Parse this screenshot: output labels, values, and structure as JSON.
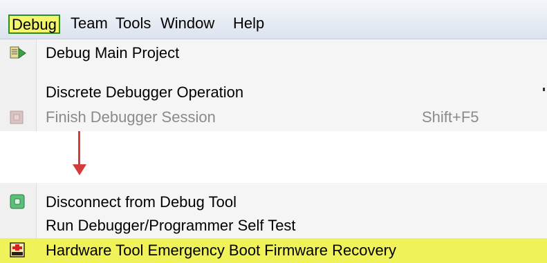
{
  "menubar": {
    "items": [
      "Debug",
      "Team",
      "Tools",
      "Window",
      "Help"
    ]
  },
  "menu_top": [
    {
      "label": "Debug Main Project",
      "icon": "debug-project-icon",
      "enabled": true
    },
    {
      "label": "Discrete Debugger Operation",
      "enabled": true,
      "has_submenu": true
    },
    {
      "label": "Finish Debugger Session",
      "shortcut": "Shift+F5",
      "icon": "stop-icon",
      "enabled": false
    }
  ],
  "menu_bottom": [
    {
      "label": "Disconnect from Debug Tool",
      "icon": "disconnect-icon",
      "enabled": true
    },
    {
      "label": "Run Debugger/Programmer Self Test",
      "enabled": true
    },
    {
      "label": "Hardware Tool Emergency Boot Firmware Recovery",
      "icon": "emergency-boot-icon",
      "enabled": true,
      "highlighted": true
    }
  ],
  "colors": {
    "highlight": "#f0f25a",
    "arrow": "#d43c3c",
    "active_menu_border": "#2c8a2c"
  }
}
